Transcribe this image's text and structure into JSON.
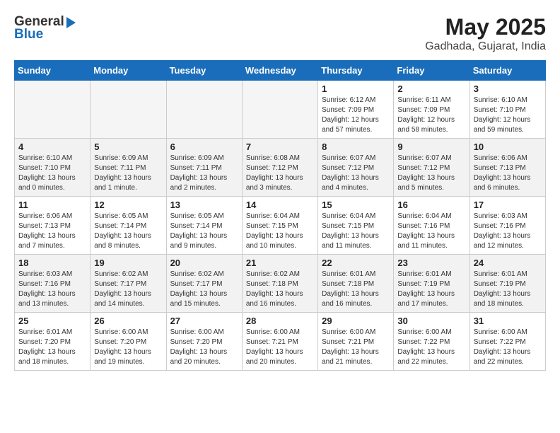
{
  "header": {
    "logo_general": "General",
    "logo_blue": "Blue",
    "month": "May 2025",
    "location": "Gadhada, Gujarat, India"
  },
  "weekdays": [
    "Sunday",
    "Monday",
    "Tuesday",
    "Wednesday",
    "Thursday",
    "Friday",
    "Saturday"
  ],
  "weeks": [
    [
      {
        "day": "",
        "info": ""
      },
      {
        "day": "",
        "info": ""
      },
      {
        "day": "",
        "info": ""
      },
      {
        "day": "",
        "info": ""
      },
      {
        "day": "1",
        "info": "Sunrise: 6:12 AM\nSunset: 7:09 PM\nDaylight: 12 hours\nand 57 minutes."
      },
      {
        "day": "2",
        "info": "Sunrise: 6:11 AM\nSunset: 7:09 PM\nDaylight: 12 hours\nand 58 minutes."
      },
      {
        "day": "3",
        "info": "Sunrise: 6:10 AM\nSunset: 7:10 PM\nDaylight: 12 hours\nand 59 minutes."
      }
    ],
    [
      {
        "day": "4",
        "info": "Sunrise: 6:10 AM\nSunset: 7:10 PM\nDaylight: 13 hours\nand 0 minutes."
      },
      {
        "day": "5",
        "info": "Sunrise: 6:09 AM\nSunset: 7:11 PM\nDaylight: 13 hours\nand 1 minute."
      },
      {
        "day": "6",
        "info": "Sunrise: 6:09 AM\nSunset: 7:11 PM\nDaylight: 13 hours\nand 2 minutes."
      },
      {
        "day": "7",
        "info": "Sunrise: 6:08 AM\nSunset: 7:12 PM\nDaylight: 13 hours\nand 3 minutes."
      },
      {
        "day": "8",
        "info": "Sunrise: 6:07 AM\nSunset: 7:12 PM\nDaylight: 13 hours\nand 4 minutes."
      },
      {
        "day": "9",
        "info": "Sunrise: 6:07 AM\nSunset: 7:12 PM\nDaylight: 13 hours\nand 5 minutes."
      },
      {
        "day": "10",
        "info": "Sunrise: 6:06 AM\nSunset: 7:13 PM\nDaylight: 13 hours\nand 6 minutes."
      }
    ],
    [
      {
        "day": "11",
        "info": "Sunrise: 6:06 AM\nSunset: 7:13 PM\nDaylight: 13 hours\nand 7 minutes."
      },
      {
        "day": "12",
        "info": "Sunrise: 6:05 AM\nSunset: 7:14 PM\nDaylight: 13 hours\nand 8 minutes."
      },
      {
        "day": "13",
        "info": "Sunrise: 6:05 AM\nSunset: 7:14 PM\nDaylight: 13 hours\nand 9 minutes."
      },
      {
        "day": "14",
        "info": "Sunrise: 6:04 AM\nSunset: 7:15 PM\nDaylight: 13 hours\nand 10 minutes."
      },
      {
        "day": "15",
        "info": "Sunrise: 6:04 AM\nSunset: 7:15 PM\nDaylight: 13 hours\nand 11 minutes."
      },
      {
        "day": "16",
        "info": "Sunrise: 6:04 AM\nSunset: 7:16 PM\nDaylight: 13 hours\nand 11 minutes."
      },
      {
        "day": "17",
        "info": "Sunrise: 6:03 AM\nSunset: 7:16 PM\nDaylight: 13 hours\nand 12 minutes."
      }
    ],
    [
      {
        "day": "18",
        "info": "Sunrise: 6:03 AM\nSunset: 7:16 PM\nDaylight: 13 hours\nand 13 minutes."
      },
      {
        "day": "19",
        "info": "Sunrise: 6:02 AM\nSunset: 7:17 PM\nDaylight: 13 hours\nand 14 minutes."
      },
      {
        "day": "20",
        "info": "Sunrise: 6:02 AM\nSunset: 7:17 PM\nDaylight: 13 hours\nand 15 minutes."
      },
      {
        "day": "21",
        "info": "Sunrise: 6:02 AM\nSunset: 7:18 PM\nDaylight: 13 hours\nand 16 minutes."
      },
      {
        "day": "22",
        "info": "Sunrise: 6:01 AM\nSunset: 7:18 PM\nDaylight: 13 hours\nand 16 minutes."
      },
      {
        "day": "23",
        "info": "Sunrise: 6:01 AM\nSunset: 7:19 PM\nDaylight: 13 hours\nand 17 minutes."
      },
      {
        "day": "24",
        "info": "Sunrise: 6:01 AM\nSunset: 7:19 PM\nDaylight: 13 hours\nand 18 minutes."
      }
    ],
    [
      {
        "day": "25",
        "info": "Sunrise: 6:01 AM\nSunset: 7:20 PM\nDaylight: 13 hours\nand 18 minutes."
      },
      {
        "day": "26",
        "info": "Sunrise: 6:00 AM\nSunset: 7:20 PM\nDaylight: 13 hours\nand 19 minutes."
      },
      {
        "day": "27",
        "info": "Sunrise: 6:00 AM\nSunset: 7:20 PM\nDaylight: 13 hours\nand 20 minutes."
      },
      {
        "day": "28",
        "info": "Sunrise: 6:00 AM\nSunset: 7:21 PM\nDaylight: 13 hours\nand 20 minutes."
      },
      {
        "day": "29",
        "info": "Sunrise: 6:00 AM\nSunset: 7:21 PM\nDaylight: 13 hours\nand 21 minutes."
      },
      {
        "day": "30",
        "info": "Sunrise: 6:00 AM\nSunset: 7:22 PM\nDaylight: 13 hours\nand 22 minutes."
      },
      {
        "day": "31",
        "info": "Sunrise: 6:00 AM\nSunset: 7:22 PM\nDaylight: 13 hours\nand 22 minutes."
      }
    ]
  ]
}
